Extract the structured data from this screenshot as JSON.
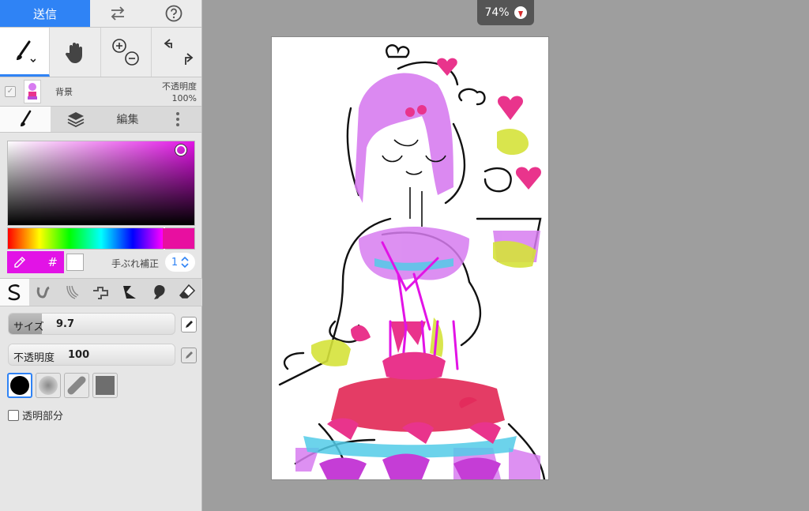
{
  "topbar": {
    "send_label": "送信",
    "swap_icon": "swap-arrows-icon",
    "help_icon": "question-circle-icon"
  },
  "tools": {
    "brush_icon": "brush-icon",
    "hand_icon": "hand-icon",
    "zoom_icon": "zoom-in-out-icon",
    "undo_redo_icon": "undo-redo-icon"
  },
  "layer": {
    "name": "背景",
    "opacity_label": "不透明度",
    "opacity_value": "100%"
  },
  "tabs": {
    "edit_label": "編集"
  },
  "color": {
    "primary": "#e213e6",
    "stabilizer_label": "手ぶれ補正",
    "stabilizer_value": "1",
    "hash": "#"
  },
  "brush": {
    "size_label": "サイズ",
    "size_value": "9.7",
    "size_fraction": 0.2,
    "opacity_label": "不透明度",
    "opacity_value": "100",
    "opacity_fraction": 1.0
  },
  "transparent_label": "透明部分",
  "zoom": {
    "value": "74%"
  },
  "colors": {
    "accent": "#2f83f5",
    "panel": "#e6e6e6",
    "workspace": "#9e9e9e",
    "magenta": "#e213e6",
    "pink": "#e80fa0"
  }
}
